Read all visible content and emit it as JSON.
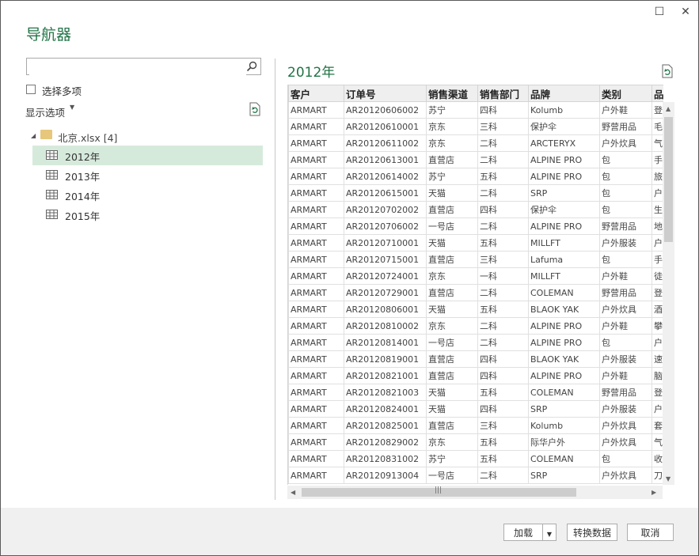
{
  "title": "导航器",
  "search": {
    "value": "",
    "placeholder": ""
  },
  "multi_select_label": "选择多项",
  "display_options_label": "显示选项",
  "tree": {
    "folder": "北京.xlsx [4]",
    "items": [
      {
        "label": "2012年",
        "selected": true
      },
      {
        "label": "2013年",
        "selected": false
      },
      {
        "label": "2014年",
        "selected": false
      },
      {
        "label": "2015年",
        "selected": false
      }
    ]
  },
  "preview": {
    "title": "2012年",
    "columns": [
      "客户",
      "订单号",
      "销售渠道",
      "销售部门",
      "品牌",
      "类别",
      "品名"
    ],
    "rows": [
      [
        "ARMART",
        "AR20120606002",
        "苏宁",
        "四科",
        "Kolumb",
        "户外鞋",
        "登"
      ],
      [
        "ARMART",
        "AR20120610001",
        "京东",
        "三科",
        "保护伞",
        "野营用品",
        "毛"
      ],
      [
        "ARMART",
        "AR20120611002",
        "京东",
        "二科",
        "ARCTERYX",
        "户外炊具",
        "气"
      ],
      [
        "ARMART",
        "AR20120613001",
        "直营店",
        "二科",
        "ALPINE PRO",
        "包",
        "手"
      ],
      [
        "ARMART",
        "AR20120614002",
        "苏宁",
        "五科",
        "ALPINE PRO",
        "包",
        "旅"
      ],
      [
        "ARMART",
        "AR20120615001",
        "天猫",
        "二科",
        "SRP",
        "包",
        "户"
      ],
      [
        "ARMART",
        "AR20120702002",
        "直营店",
        "四科",
        "保护伞",
        "包",
        "生"
      ],
      [
        "ARMART",
        "AR20120706002",
        "一号店",
        "二科",
        "ALPINE PRO",
        "野营用品",
        "地"
      ],
      [
        "ARMART",
        "AR20120710001",
        "天猫",
        "五科",
        "MILLFT",
        "户外服装",
        "户"
      ],
      [
        "ARMART",
        "AR20120715001",
        "直营店",
        "三科",
        "Lafuma",
        "包",
        "手"
      ],
      [
        "ARMART",
        "AR20120724001",
        "京东",
        "一科",
        "MILLFT",
        "户外鞋",
        "徒"
      ],
      [
        "ARMART",
        "AR20120729001",
        "直营店",
        "二科",
        "COLEMAN",
        "野营用品",
        "登"
      ],
      [
        "ARMART",
        "AR20120806001",
        "天猫",
        "五科",
        "BLAOK YAK",
        "户外炊具",
        "酒"
      ],
      [
        "ARMART",
        "AR20120810002",
        "京东",
        "二科",
        "ALPINE PRO",
        "户外鞋",
        "攀"
      ],
      [
        "ARMART",
        "AR20120814001",
        "一号店",
        "二科",
        "ALPINE PRO",
        "包",
        "户"
      ],
      [
        "ARMART",
        "AR20120819001",
        "直营店",
        "四科",
        "BLAOK YAK",
        "户外服装",
        "速"
      ],
      [
        "ARMART",
        "AR20120821001",
        "直营店",
        "四科",
        "ALPINE PRO",
        "户外鞋",
        "脑"
      ],
      [
        "ARMART",
        "AR20120821003",
        "天猫",
        "五科",
        "COLEMAN",
        "野营用品",
        "登"
      ],
      [
        "ARMART",
        "AR20120824001",
        "天猫",
        "四科",
        "SRP",
        "户外服装",
        "户"
      ],
      [
        "ARMART",
        "AR20120825001",
        "直营店",
        "三科",
        "Kolumb",
        "户外炊具",
        "套"
      ],
      [
        "ARMART",
        "AR20120829002",
        "京东",
        "五科",
        "际华户外",
        "户外炊具",
        "气"
      ],
      [
        "ARMART",
        "AR20120831002",
        "苏宁",
        "五科",
        "COLEMAN",
        "包",
        "收"
      ],
      [
        "ARMART",
        "AR20120913004",
        "一号店",
        "二科",
        "SRP",
        "户外炊具",
        "刀"
      ]
    ]
  },
  "footer": {
    "load_label": "加载",
    "transform_label": "转换数据",
    "cancel_label": "取消"
  },
  "colors": {
    "accent": "#217346",
    "selected_bg": "#d6eadc"
  }
}
